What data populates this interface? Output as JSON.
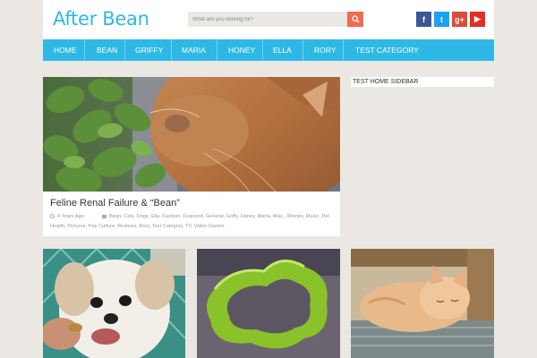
{
  "header": {
    "logo": "After Bean",
    "search_placeholder": "What are you looking for?",
    "social": {
      "facebook": "f",
      "twitter": "t",
      "google_plus": "g+",
      "youtube": "▶"
    }
  },
  "nav": {
    "items": [
      "HOME",
      "BEAN",
      "GRIFFY",
      "MARIA",
      "HONEY",
      "ELLA",
      "RORY",
      "TEST CATEGORY"
    ]
  },
  "featured_post": {
    "title": "Feline Renal Failure & “Bean”",
    "age": "4 Years Ago",
    "tags_line1": "Bean, Cats, Dogs, Ella, Fashion, Featured, General, Griffy, Honey, Maria, Misc., Movies, Music, Pet",
    "tags_line2": "Health, Pictures, Pop Culture, Reviews, Rory, Test Category, TV, Video Games"
  },
  "sidebar": {
    "title": "TEST HOME SIDEBAR"
  },
  "colors": {
    "accent": "#2eb8e6",
    "search_button": "#f26b4f",
    "background": "#ebe8e4",
    "facebook": "#3b5998",
    "twitter": "#1da1f2",
    "google_plus": "#dd4b39",
    "youtube": "#e52d27"
  }
}
